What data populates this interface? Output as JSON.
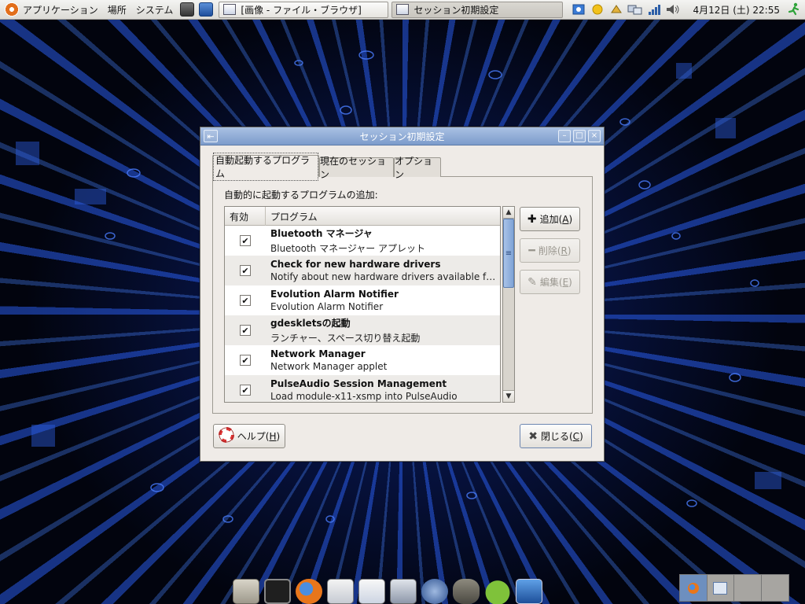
{
  "top_panel": {
    "applications": "アプリケーション",
    "places": "場所",
    "system": "システム",
    "tasks": [
      {
        "label": "[画像 - ファイル・ブラウザ]",
        "active": false
      },
      {
        "label": "セッション初期設定",
        "active": true
      }
    ],
    "clock": "4月12日 (土) 22:55",
    "tray_icons": [
      "puzzle-icon",
      "weather-icon",
      "keyring-icon",
      "network-icon",
      "signal-strength-icon",
      "volume-icon"
    ]
  },
  "dialog": {
    "title": "セッション初期設定",
    "tabs": [
      {
        "label": "自動起動するプログラム",
        "selected": true
      },
      {
        "label": "現在のセッション",
        "selected": false
      },
      {
        "label": "オプション",
        "selected": false
      }
    ],
    "section_label": "自動的に起動するプログラムの追加:",
    "columns": [
      "有効",
      "プログラム"
    ],
    "rows": [
      {
        "enabled": true,
        "name": "Bluetooth マネージャ",
        "desc": "Bluetooth マネージャー アプレット"
      },
      {
        "enabled": true,
        "name": "Check for new hardware drivers",
        "desc": "Notify about new hardware drivers available for t…"
      },
      {
        "enabled": true,
        "name": "Evolution Alarm Notifier",
        "desc": "Evolution Alarm Notifier"
      },
      {
        "enabled": true,
        "name": "gdeskletsの起動",
        "desc": "ランチャー、スペース切り替え起動"
      },
      {
        "enabled": true,
        "name": "Network Manager",
        "desc": "Network Manager applet"
      },
      {
        "enabled": true,
        "name": "PulseAudio Session Management",
        "desc": "Load module-x11-xsmp into PulseAudio"
      }
    ],
    "buttons": {
      "add": {
        "label": "追加(",
        "mnemonic": "A",
        "suffix": ")"
      },
      "remove": {
        "label": "削除(",
        "mnemonic": "R",
        "suffix": ")"
      },
      "edit": {
        "label": "編集(",
        "mnemonic": "E",
        "suffix": ")"
      },
      "help": {
        "label": "ヘルプ(",
        "mnemonic": "H",
        "suffix": ")"
      },
      "close": {
        "label": "閉じる(",
        "mnemonic": "C",
        "suffix": ")"
      }
    }
  },
  "dock": {
    "icons": [
      "home-folder-icon",
      "terminal-icon",
      "firefox-icon",
      "mail-icon",
      "calendar-icon",
      "settings-icon",
      "browser-icon",
      "gimp-icon",
      "android-icon",
      "system-monitor-icon"
    ]
  },
  "colors": {
    "titlebar": "#7c9bcb",
    "dialog_bg": "#efebe7",
    "scroll_thumb": "#7fa3d6"
  }
}
